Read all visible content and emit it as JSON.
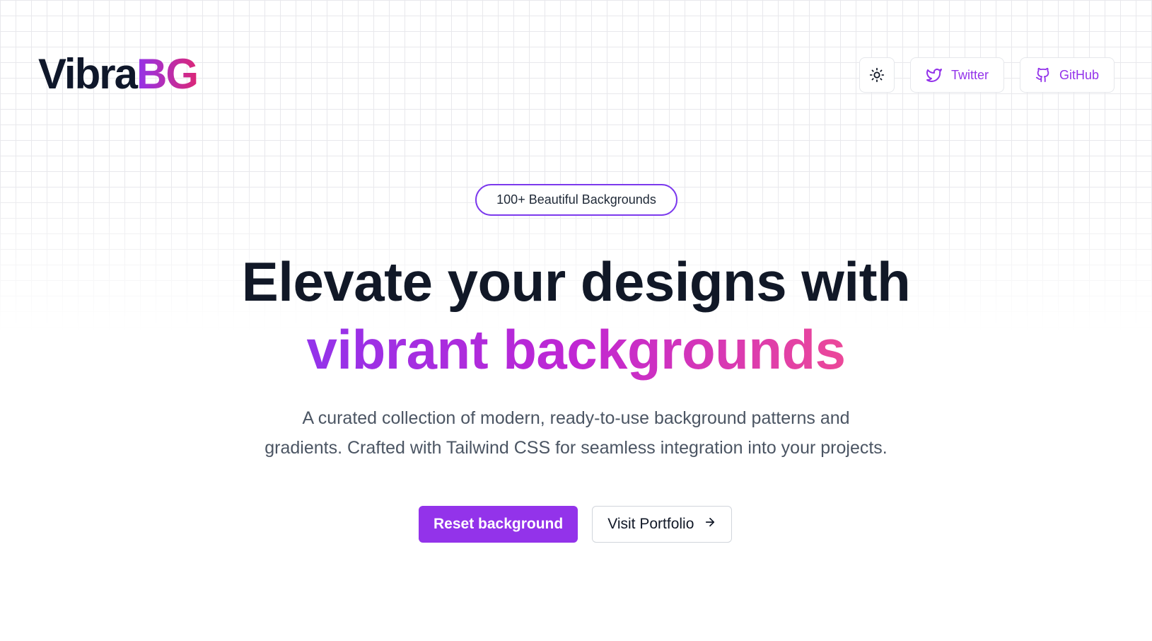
{
  "header": {
    "logo_part1": "Vibra",
    "logo_part2": "BG",
    "theme_toggle_icon": "sun-icon",
    "twitter_label": "Twitter",
    "github_label": "GitHub"
  },
  "hero": {
    "badge": "100+ Beautiful Backgrounds",
    "headline_line1": "Elevate your designs with",
    "headline_line2": "vibrant backgrounds",
    "subtitle_line1": "A curated collection of modern, ready-to-use background patterns and",
    "subtitle_line2": "gradients. Crafted with Tailwind CSS for seamless integration into your projects.",
    "primary_button": "Reset background",
    "secondary_button": "Visit Portfolio"
  },
  "colors": {
    "accent": "#9333ea",
    "gradient_end": "#ec4899",
    "text_dark": "#111827",
    "text_muted": "#4b5563"
  }
}
